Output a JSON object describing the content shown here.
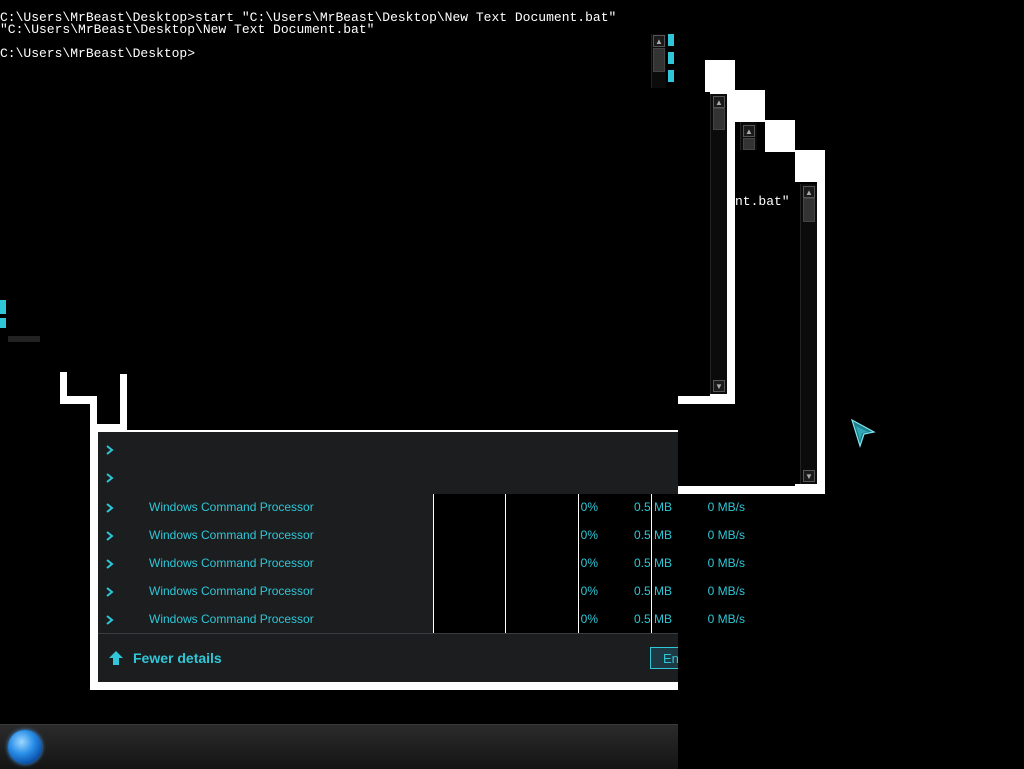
{
  "console": {
    "line1": "C:\\Users\\MrBeast\\Desktop>start \"C:\\Users\\MrBeast\\Desktop\\New Text Document.bat\"",
    "line2": "\"C:\\Users\\MrBeast\\Desktop\\New Text Document.bat\"",
    "line3": "C:\\Users\\MrBeast\\Desktop>",
    "fragment": "nt.bat\""
  },
  "task_manager": {
    "rows": [
      {
        "name": "Windows Command Processor",
        "cpu": "0%",
        "memory": "0.5 MB",
        "disk": "0 MB/s"
      },
      {
        "name": "Windows Command Processor",
        "cpu": "0%",
        "memory": "0.5 MB",
        "disk": "0 MB/s"
      },
      {
        "name": "Windows Command Processor",
        "cpu": "0%",
        "memory": "0.5 MB",
        "disk": "0 MB/s"
      },
      {
        "name": "Windows Command Processor",
        "cpu": "0%",
        "memory": "0.5 MB",
        "disk": "0 MB/s"
      },
      {
        "name": "Windows Command Processor",
        "cpu": "0%",
        "memory": "0.5 MB",
        "disk": "0 MB/s"
      }
    ],
    "fewer_details": "Fewer details",
    "end_task_fragment": "En"
  },
  "icons": {
    "up_arrow": "▲",
    "down_arrow": "▼",
    "fewer_details_icon": "arrow-up-icon",
    "row_chevron": "chevron-right-icon"
  },
  "colors": {
    "accent_cyan": "#2fc7d8",
    "background": "#000000"
  }
}
